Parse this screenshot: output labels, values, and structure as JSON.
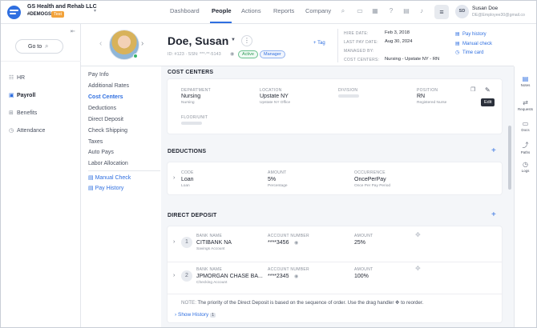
{
  "org": {
    "name": "GS Health and Rehab LLC",
    "code": "#DEMOGS",
    "tag": "Test"
  },
  "nav": {
    "tabs": [
      "Dashboard",
      "People",
      "Actions",
      "Reports",
      "Company"
    ]
  },
  "user": {
    "initials": "SD",
    "name": "Susan Doe",
    "email": "DE@Employee30@gmail.co"
  },
  "sidebar": {
    "goto_label": "Go to",
    "items": [
      {
        "label": "HR",
        "icon": "hr-icon"
      },
      {
        "label": "Payroll",
        "icon": "payroll-icon"
      },
      {
        "label": "Benefits",
        "icon": "benefits-icon"
      },
      {
        "label": "Attendance",
        "icon": "attendance-icon"
      }
    ]
  },
  "employee": {
    "name": "Doe, Susan",
    "ids": "ID: #123 · SSN: ***-**-5143",
    "badges": {
      "status": "Active",
      "role": "Manager"
    },
    "add_tag": "+ Tag",
    "info": [
      {
        "label": "HIRE DATE:",
        "value": "Feb 3, 2018"
      },
      {
        "label": "LAST PAY DATE:",
        "value": "Aug 30, 2024"
      },
      {
        "label": "MANAGED BY:",
        "value": ""
      },
      {
        "label": "COST CENTERS:",
        "value": "Nursing - Upstate NY - RN"
      }
    ],
    "quick_links": [
      "Pay history",
      "Manual check",
      "Time card"
    ]
  },
  "subnav": {
    "items": [
      "Pay Info",
      "Additional Rates",
      "Cost Centers",
      "Deductions",
      "Direct Deposit",
      "Check Shipping",
      "Taxes",
      "Auto Pays",
      "Labor Allocation"
    ],
    "links": [
      "Manual Check",
      "Pay History"
    ]
  },
  "cost_centers": {
    "title": "COST CENTERS",
    "department": {
      "label": "DEPARTMENT",
      "value": "Nursing",
      "sub": "Nursing"
    },
    "location": {
      "label": "LOCATION",
      "value": "Upstate NY",
      "sub": "Upstate NY Office"
    },
    "division": {
      "label": "DIVISION"
    },
    "position": {
      "label": "POSITION",
      "value": "RN",
      "sub": "Registered Nurse"
    },
    "floor": {
      "label": "FLOOR/UNIT"
    },
    "tooltip": "Edit"
  },
  "deductions": {
    "title": "DEDUCTIONS",
    "code": {
      "label": "CODE",
      "value": "Loan",
      "sub": "Loan"
    },
    "amount": {
      "label": "AMOUNT",
      "value": "5%",
      "sub": "Percentage"
    },
    "occurrence": {
      "label": "OCCURRENCE",
      "value": "OncePerPay",
      "sub": "Once Per Pay Period"
    }
  },
  "direct_deposit": {
    "title": "DIRECT DEPOSIT",
    "rows": [
      {
        "num": "1",
        "bank_label": "BANK NAME",
        "bank": "CITIBANK NA",
        "type": "Savings Account",
        "acct_label": "ACCOUNT NUMBER",
        "acct": "****3456",
        "amt_label": "AMOUNT",
        "amount": "25%"
      },
      {
        "num": "2",
        "bank_label": "BANK NAME",
        "bank": "JPMORGAN CHASE BA...",
        "type": "Checking Account",
        "acct_label": "ACCOUNT NUMBER",
        "acct": "****2345",
        "amt_label": "AMOUNT",
        "amount": "100%"
      }
    ],
    "note_label": "NOTE:",
    "note": "The priority of the Direct Deposit is based on the sequence of order. Use the drag handler",
    "note_end": "to reorder.",
    "history_label": "Show History",
    "history_count": "1"
  },
  "right_panel": {
    "items": [
      "Notes",
      "Requests",
      "Docs",
      "Paths",
      "Logs"
    ]
  }
}
